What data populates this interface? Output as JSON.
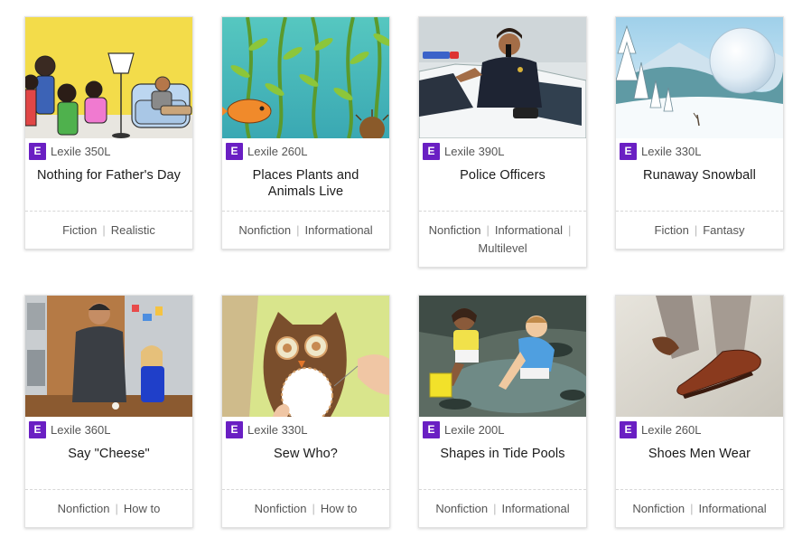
{
  "cards": [
    {
      "level": "E",
      "lexile": "Lexile 350L",
      "title": "Nothing for Father's Day",
      "tags": [
        "Fiction",
        "Realistic"
      ],
      "image": "family-living-room-illustration"
    },
    {
      "level": "E",
      "lexile": "Lexile 260L",
      "title": "Places Plants and Animals Live",
      "tags": [
        "Nonfiction",
        "Informational"
      ],
      "image": "kelp-forest-fish-illustration"
    },
    {
      "level": "E",
      "lexile": "Lexile 390L",
      "title": "Police Officers",
      "tags": [
        "Nonfiction",
        "Informational",
        "Multilevel"
      ],
      "image": "police-officer-car-photo"
    },
    {
      "level": "E",
      "lexile": "Lexile 330L",
      "title": "Runaway Snowball",
      "tags": [
        "Fiction",
        "Fantasy"
      ],
      "image": "snowy-mountain-snowball-illustration"
    },
    {
      "level": "E",
      "lexile": "Lexile 360L",
      "title": "Say \"Cheese\"",
      "tags": [
        "Nonfiction",
        "How to"
      ],
      "image": "father-daughter-kitchen-photo"
    },
    {
      "level": "E",
      "lexile": "Lexile 330L",
      "title": "Sew Who?",
      "tags": [
        "Nonfiction",
        "How to"
      ],
      "image": "felt-owl-sewing-photo"
    },
    {
      "level": "E",
      "lexile": "Lexile 200L",
      "title": "Shapes in Tide Pools",
      "tags": [
        "Nonfiction",
        "Informational"
      ],
      "image": "children-tide-pool-photo"
    },
    {
      "level": "E",
      "lexile": "Lexile 260L",
      "title": "Shoes Men Wear",
      "tags": [
        "Nonfiction",
        "Informational"
      ],
      "image": "mens-leather-shoe-photo"
    }
  ],
  "colors": {
    "level_badge": "#6a1fc3"
  }
}
